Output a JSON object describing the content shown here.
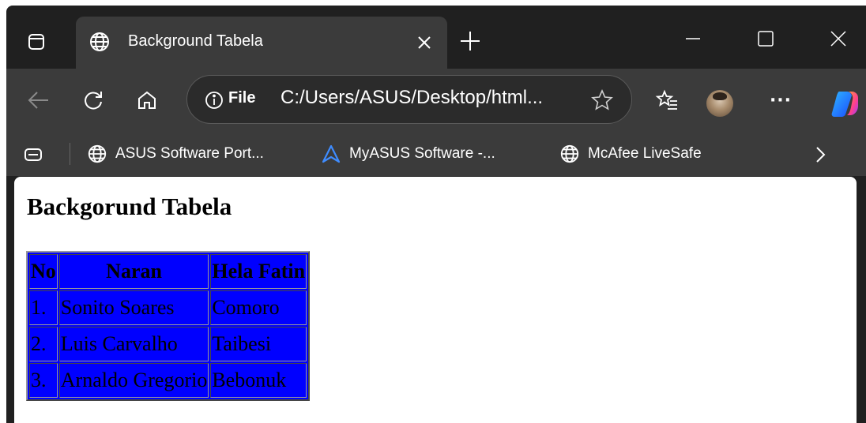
{
  "browser": {
    "tab": {
      "title": "Background Tabela",
      "favicon": "globe-icon"
    },
    "window_controls": [
      "minimize-icon",
      "maximize-icon",
      "close-icon"
    ],
    "toolbar": {
      "back": "back-arrow-icon",
      "refresh": "refresh-icon",
      "home": "home-icon",
      "address": {
        "scheme_label": "File",
        "url": "C:/Users/ASUS/Desktop/html..."
      },
      "more": "···"
    },
    "bookmarks": [
      {
        "label": "ASUS Software Port...",
        "icon": "globe-icon"
      },
      {
        "label": "MyASUS Software -...",
        "icon": "asus-logo-icon"
      },
      {
        "label": "McAfee LiveSafe",
        "icon": "globe-icon"
      }
    ]
  },
  "page": {
    "heading": "Backgorund Tabela",
    "table": {
      "background": "#0000ff",
      "headers": [
        "No",
        "Naran",
        "Hela Fatin"
      ],
      "rows": [
        [
          "1.",
          "Sonito Soares",
          "Comoro"
        ],
        [
          "2.",
          "Luis Carvalho",
          "Taibesi"
        ],
        [
          "3.",
          "Arnaldo Gregorio",
          "Bebonuk"
        ]
      ]
    }
  }
}
